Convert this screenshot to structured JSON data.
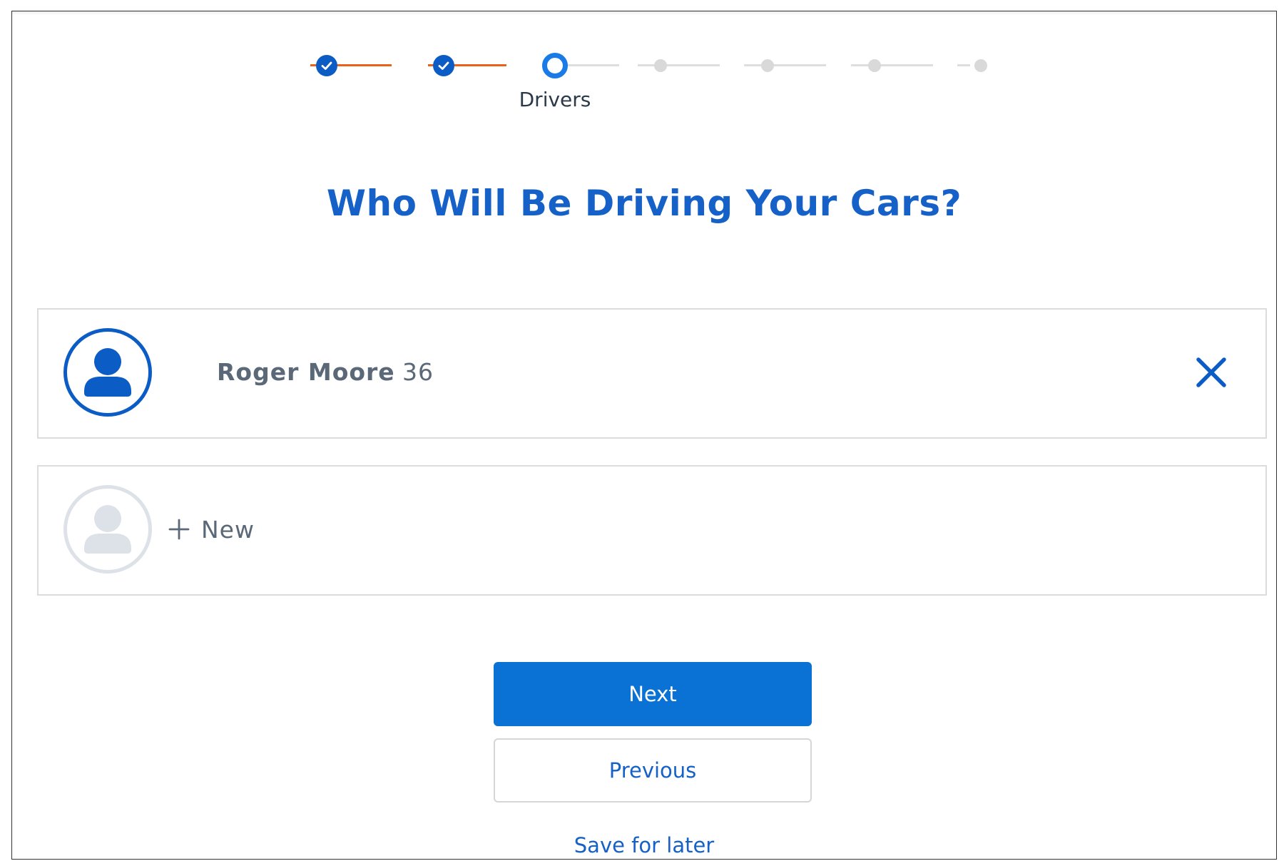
{
  "stepper": {
    "current_step_label": "Drivers",
    "steps": [
      {
        "status": "done",
        "icon": "check-icon"
      },
      {
        "status": "done",
        "icon": "check-icon"
      },
      {
        "status": "current",
        "label": "Drivers"
      },
      {
        "status": "todo"
      },
      {
        "status": "todo"
      },
      {
        "status": "todo"
      },
      {
        "status": "todo"
      }
    ],
    "colors": {
      "done": "#0b5cc4",
      "current": "#1a7be6",
      "done_line": "#e8631a",
      "todo": "#d9d9d9"
    }
  },
  "page": {
    "title": "Who Will Be Driving Your Cars?"
  },
  "drivers": [
    {
      "name": "Roger Moore",
      "age": "36",
      "avatar_icon": "user-avatar-icon",
      "remove_icon": "close-icon"
    }
  ],
  "add_driver": {
    "label": "New",
    "icon": "plus-icon",
    "avatar_icon": "user-avatar-placeholder-icon"
  },
  "actions": {
    "next_label": "Next",
    "previous_label": "Previous",
    "save_label": "Save for later"
  },
  "colors": {
    "primary": "#0a72d4",
    "title": "#1661c7",
    "text_muted": "#5a6878"
  }
}
